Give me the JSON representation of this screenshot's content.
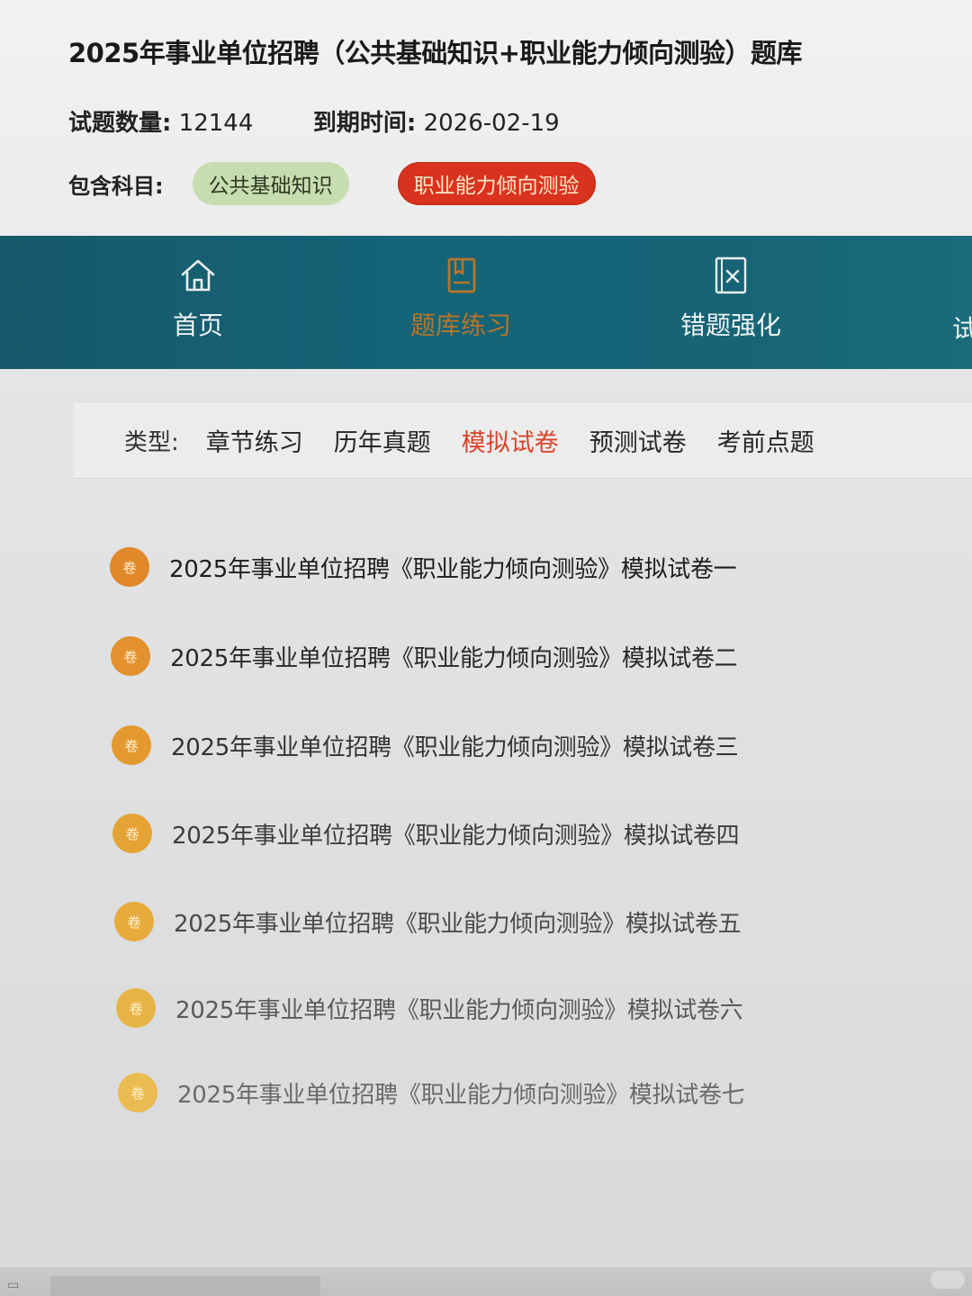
{
  "header": {
    "title": "2025年事业单位招聘（公共基础知识+职业能力倾向测验）题库",
    "question_count_label": "试题数量:",
    "question_count": "12144",
    "expiry_label": "到期时间:",
    "expiry_date": "2026-02-19",
    "subjects_label": "包含科目:",
    "subjects": [
      {
        "label": "公共基础知识",
        "selected": false
      },
      {
        "label": "职业能力倾向测验",
        "selected": true
      }
    ]
  },
  "nav": {
    "items": [
      {
        "label": "首页",
        "icon": "home-icon",
        "active": false
      },
      {
        "label": "题库练习",
        "icon": "book-icon",
        "active": true
      },
      {
        "label": "错题强化",
        "icon": "wrong-question-icon",
        "active": false
      }
    ],
    "overflow_label": "试"
  },
  "type_filter": {
    "label": "类型:",
    "tabs": [
      {
        "label": "章节练习",
        "active": false
      },
      {
        "label": "历年真题",
        "active": false
      },
      {
        "label": "模拟试卷",
        "active": true
      },
      {
        "label": "预测试卷",
        "active": false
      },
      {
        "label": "考前点题",
        "active": false
      }
    ]
  },
  "papers": {
    "badge_text": "卷",
    "items": [
      "2025年事业单位招聘《职业能力倾向测验》模拟试卷一",
      "2025年事业单位招聘《职业能力倾向测验》模拟试卷二",
      "2025年事业单位招聘《职业能力倾向测验》模拟试卷三",
      "2025年事业单位招聘《职业能力倾向测验》模拟试卷四",
      "2025年事业单位招聘《职业能力倾向测验》模拟试卷五",
      "2025年事业单位招聘《职业能力倾向测验》模拟试卷六",
      "2025年事业单位招聘《职业能力倾向测验》模拟试卷七"
    ]
  },
  "colors": {
    "nav_bg": "#146478",
    "active_orange": "#b7752a",
    "active_red": "#d9442b",
    "badge_orange": "#e0902a",
    "chip_green": "#c7ddb0",
    "chip_red": "#d9331f"
  }
}
